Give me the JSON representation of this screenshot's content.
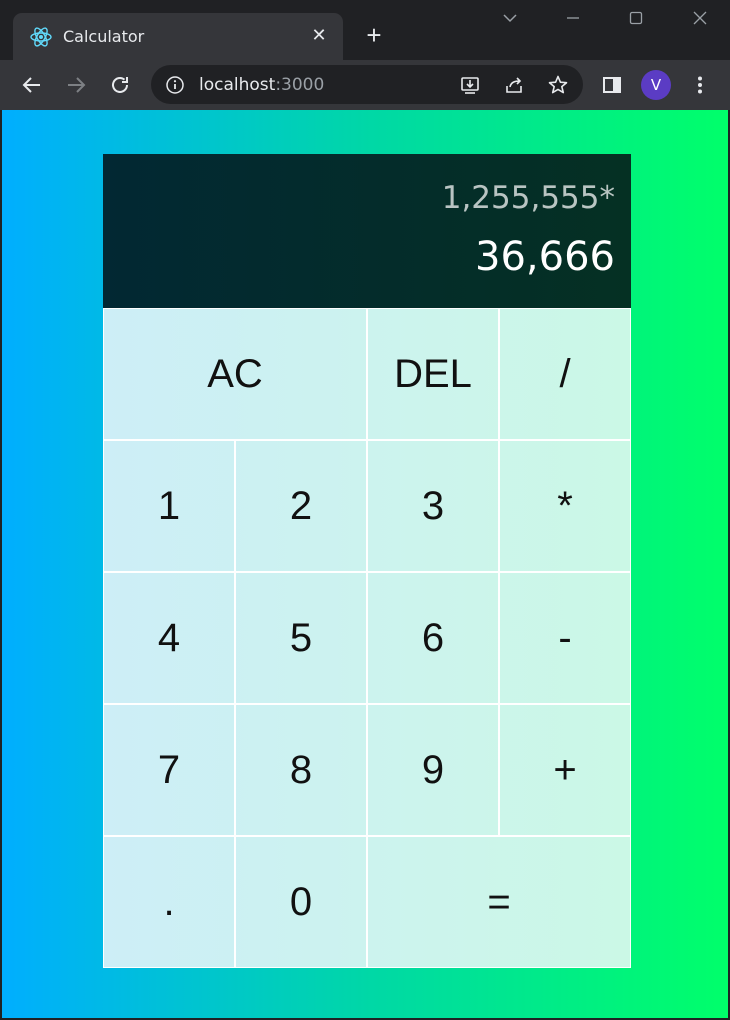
{
  "browser": {
    "tab_title": "Calculator",
    "url_host": "localhost",
    "url_port": ":3000",
    "profile_initial": "V"
  },
  "calculator": {
    "previous_operand": "1,255,555*",
    "current_operand": "36,666",
    "keys": {
      "ac": "AC",
      "del": "DEL",
      "divide": "/",
      "one": "1",
      "two": "2",
      "three": "3",
      "multiply": "*",
      "four": "4",
      "five": "5",
      "six": "6",
      "subtract": "-",
      "seven": "7",
      "eight": "8",
      "nine": "9",
      "add": "+",
      "decimal": ".",
      "zero": "0",
      "equals": "="
    }
  },
  "colors": {
    "page_gradient_start": "#00aeff",
    "page_gradient_end": "#00ff6a",
    "display_background": "#022833",
    "avatar": "#5b3cc4"
  }
}
